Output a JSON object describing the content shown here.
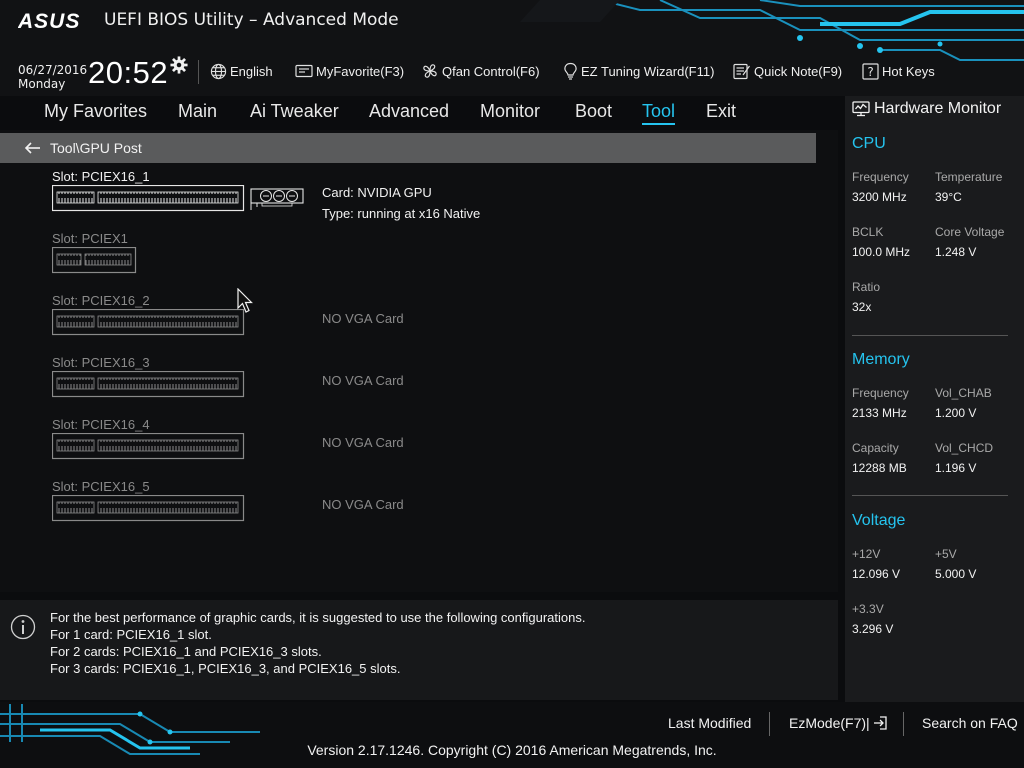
{
  "header": {
    "brand": "ASUS",
    "title": "UEFI BIOS Utility – Advanced Mode",
    "date": "06/27/2016",
    "weekday": "Monday",
    "time": "20:52",
    "accent_color": "#25c4ef"
  },
  "toolbar": {
    "language": "English",
    "my_favorite": "MyFavorite(F3)",
    "qfan": "Qfan Control(F6)",
    "ez_tuning": "EZ Tuning Wizard(F11)",
    "quick_note": "Quick Note(F9)",
    "hot_keys": "Hot Keys"
  },
  "nav": {
    "tabs": [
      {
        "label": "My Favorites"
      },
      {
        "label": "Main"
      },
      {
        "label": "Ai Tweaker"
      },
      {
        "label": "Advanced"
      },
      {
        "label": "Monitor"
      },
      {
        "label": "Boot"
      },
      {
        "label": "Tool"
      },
      {
        "label": "Exit"
      }
    ],
    "active": "Tool"
  },
  "breadcrumb": "Tool\\GPU Post",
  "slots": [
    {
      "label": "Slot: PCIEX16_1",
      "state": "active",
      "card": "Card: NVIDIA GPU",
      "type": "Type: running at x16 Native"
    },
    {
      "label": "Slot: PCIEX1",
      "state": "inactive",
      "status": ""
    },
    {
      "label": "Slot: PCIEX16_2",
      "state": "inactive",
      "status": "NO VGA Card"
    },
    {
      "label": "Slot: PCIEX16_3",
      "state": "inactive",
      "status": "NO VGA Card"
    },
    {
      "label": "Slot: PCIEX16_4",
      "state": "inactive",
      "status": "NO VGA Card"
    },
    {
      "label": "Slot: PCIEX16_5",
      "state": "inactive",
      "status": "NO VGA Card"
    }
  ],
  "info": {
    "lines": [
      "For the best performance of graphic cards, it is suggested to use the following configurations.",
      "For 1 card: PCIEX16_1 slot.",
      "For 2 cards: PCIEX16_1 and PCIEX16_3 slots.",
      "For 3 cards: PCIEX16_1, PCIEX16_3, and PCIEX16_5 slots."
    ]
  },
  "hardware_monitor": {
    "title": "Hardware Monitor",
    "cpu": {
      "heading": "CPU",
      "frequency_label": "Frequency",
      "frequency": "3200 MHz",
      "temperature_label": "Temperature",
      "temperature": "39°C",
      "bclk_label": "BCLK",
      "bclk": "100.0 MHz",
      "core_voltage_label": "Core Voltage",
      "core_voltage": "1.248 V",
      "ratio_label": "Ratio",
      "ratio": "32x"
    },
    "memory": {
      "heading": "Memory",
      "frequency_label": "Frequency",
      "frequency": "2133 MHz",
      "vol_chab_label": "Vol_CHAB",
      "vol_chab": "1.200 V",
      "capacity_label": "Capacity",
      "capacity": "12288 MB",
      "vol_chcd_label": "Vol_CHCD",
      "vol_chcd": "1.196 V"
    },
    "voltage": {
      "heading": "Voltage",
      "v12_label": "+12V",
      "v12": "12.096 V",
      "v5_label": "+5V",
      "v5": "5.000 V",
      "v33_label": "+3.3V",
      "v33": "3.296 V"
    }
  },
  "footer": {
    "last_modified": "Last Modified",
    "ez_mode": "EzMode(F7)|",
    "search_faq": "Search on FAQ",
    "version": "Version 2.17.1246. Copyright (C) 2016 American Megatrends, Inc."
  }
}
